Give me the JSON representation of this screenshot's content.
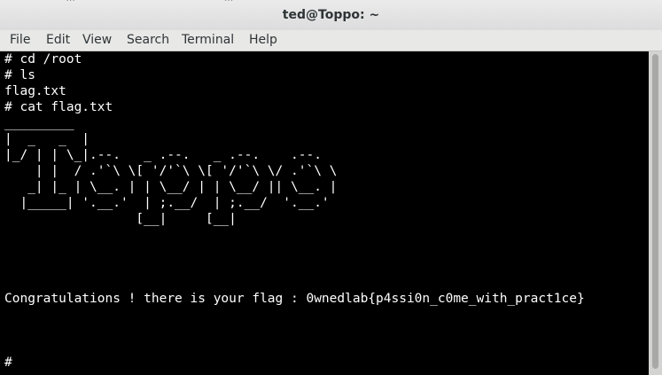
{
  "window": {
    "title": "ted@Toppo: ~",
    "bleed_text": "                   ...                                                ..."
  },
  "menu": [
    "File",
    "Edit",
    "View",
    "Search",
    "Terminal",
    "Help"
  ],
  "terminal": {
    "lines": [
      "# cd /root",
      "# ls",
      "flag.txt",
      "# cat flag.txt",
      "_________",
      "|  _   _  |",
      "|_/ | | \\_|.--.   _ .--.   _ .--.    .--.",
      "    | |  / .'`\\ \\[ '/'`\\ \\[ '/'`\\ \\/ .'`\\ \\",
      "   _| |_ | \\__. | | \\__/ | | \\__/ || \\__. |",
      "  |_____| '.__.'  | ;.__/  | ;.__/  '.__.'",
      "                 [__|     [__|",
      "Congratulations ! there is your flag : 0wnedlab{p4ssi0n_c0me_with_pract1ce}",
      "#"
    ]
  }
}
